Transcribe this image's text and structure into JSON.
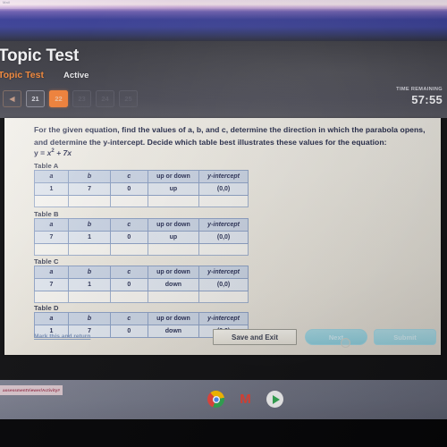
{
  "browser": {
    "tiny_chrome_text": "Mail"
  },
  "header": {
    "title": "Topic Test",
    "tab_name": "Topic Test",
    "status": "Active",
    "timer_label": "TIME REMAINING",
    "timer_value": "57:55"
  },
  "question_nav": {
    "prev_icon": "◀",
    "items": [
      {
        "label": "21",
        "state": "seen"
      },
      {
        "label": "22",
        "state": "current"
      },
      {
        "label": "23",
        "state": "dim"
      },
      {
        "label": "24",
        "state": "dim"
      },
      {
        "label": "25",
        "state": "dim"
      }
    ]
  },
  "question": {
    "line1": "For the given equation, find the values of a, b, and c, determine the direction in which the parabola opens, and",
    "line2": "determine the y-intercept.  Decide which table best illustrates these values for the equation:",
    "equation_lhs": "y =",
    "equation_var": "x",
    "equation_exp": "2",
    "equation_rest": "+ 7x"
  },
  "tables": {
    "columns": [
      "a",
      "b",
      "c",
      "up or down",
      "y-intercept"
    ],
    "items": [
      {
        "label": "Table A",
        "values": [
          "1",
          "7",
          "0",
          "up",
          "(0,0)"
        ]
      },
      {
        "label": "Table B",
        "values": [
          "7",
          "1",
          "0",
          "up",
          "(0,0)"
        ]
      },
      {
        "label": "Table C",
        "values": [
          "7",
          "1",
          "0",
          "down",
          "(0,0)"
        ]
      },
      {
        "label": "Table D",
        "values": [
          "1",
          "7",
          "0",
          "down",
          "(0,0)"
        ]
      }
    ]
  },
  "footer": {
    "mark_link": "Mark this and return",
    "save_label": "Save and Exit",
    "next_label": "Next",
    "submit_label": "Submit"
  },
  "shelf": {
    "url_chip": "assessmentViewer/Activity#",
    "icons": [
      "chrome-icon",
      "gmail-icon",
      "play-store-icon"
    ],
    "gmail_glyph": "M"
  },
  "colors": {
    "accent_orange": "#f1823b",
    "header_dark": "#41414a",
    "card_cream": "#efece4",
    "table_header_blue": "#ccd6e6",
    "teal_button": "#9ad5e2"
  }
}
